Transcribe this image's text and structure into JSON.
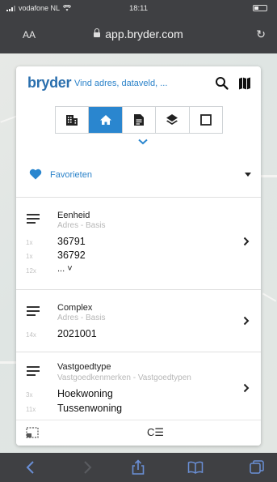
{
  "status": {
    "carrier": "vodafone NL",
    "time": "18:11"
  },
  "browser": {
    "text_size": "AA",
    "url": "app.bryder.com"
  },
  "app": {
    "logo": "bryder",
    "search_placeholder": "Vind adres, dataveld, ...",
    "toolbar": {
      "icons": [
        "building-icon",
        "home-icon",
        "document-icon",
        "layers-icon",
        "square-icon"
      ],
      "active_index": 1,
      "accent": "#2a86cf"
    },
    "favorites_label": "Favorieten",
    "sections": [
      {
        "title": "Eenheid",
        "subtitle": "Adres - Basis",
        "rows": [
          {
            "count": "1x",
            "value": "36791"
          },
          {
            "count": "1x",
            "value": "36792"
          },
          {
            "count": "12x",
            "value": "... ˅"
          }
        ]
      },
      {
        "title": "Complex",
        "subtitle": "Adres - Basis",
        "rows": [
          {
            "count": "14x",
            "value": "2021001"
          }
        ]
      },
      {
        "title": "Vastgoedtype",
        "subtitle": "Vastgoedkenmerken - Vastgoedtypen",
        "rows": [
          {
            "count": "3x",
            "value": "Hoekwoning"
          },
          {
            "count": "11x",
            "value": "Tussenwoning"
          }
        ]
      }
    ],
    "bottom_bar": {
      "right_label": "C☰"
    }
  }
}
